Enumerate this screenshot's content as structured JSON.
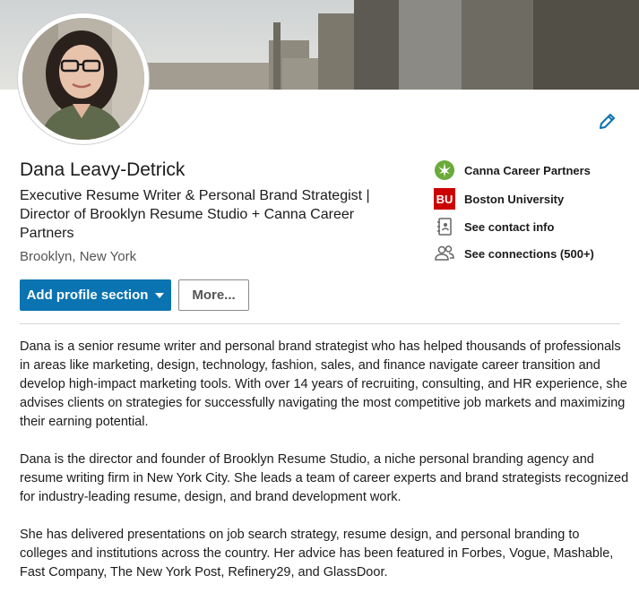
{
  "profile": {
    "name": "Dana Leavy-Detrick",
    "headline": "Executive Resume Writer & Personal Brand Strategist | Director of Brooklyn Resume Studio + Canna Career Partners",
    "location": "Brooklyn, New York"
  },
  "actions": {
    "add_section_label": "Add profile section",
    "more_label": "More..."
  },
  "sidebar": {
    "items": [
      {
        "label": "Canna Career Partners",
        "icon": "cannabis-leaf-logo"
      },
      {
        "label": "Boston University",
        "icon": "bu-logo",
        "logo_text": "BU"
      },
      {
        "label": "See contact info",
        "icon": "contact-card-icon"
      },
      {
        "label": "See connections (500+)",
        "icon": "people-icon"
      }
    ]
  },
  "summary": {
    "paragraphs": [
      "Dana is a senior resume writer and personal brand strategist who has helped thousands of professionals in areas like marketing, design, technology, fashion, sales, and finance navigate career transition and develop high-impact marketing tools. With over 14 years of recruiting, consulting, and HR experience, she advises clients on strategies for successfully navigating the most competitive job markets and maximizing their earning potential.",
      "Dana is the director and founder of Brooklyn Resume Studio, a niche personal branding agency and resume writing firm in New York City. She leads a team of career experts and brand strategists recognized for industry-leading resume, design, and brand development work.",
      "She has delivered presentations on job search strategy, resume design, and personal branding to colleges and institutions across the country. Her advice has been featured in Forbes, Vogue, Mashable, Fast Company, The New York Post, Refinery29, and GlassDoor."
    ]
  },
  "colors": {
    "primary_button": "#0a73b1",
    "edit_icon": "#0a73b1",
    "bu_red": "#cc0000",
    "leaf_green": "#6aaa3a"
  }
}
